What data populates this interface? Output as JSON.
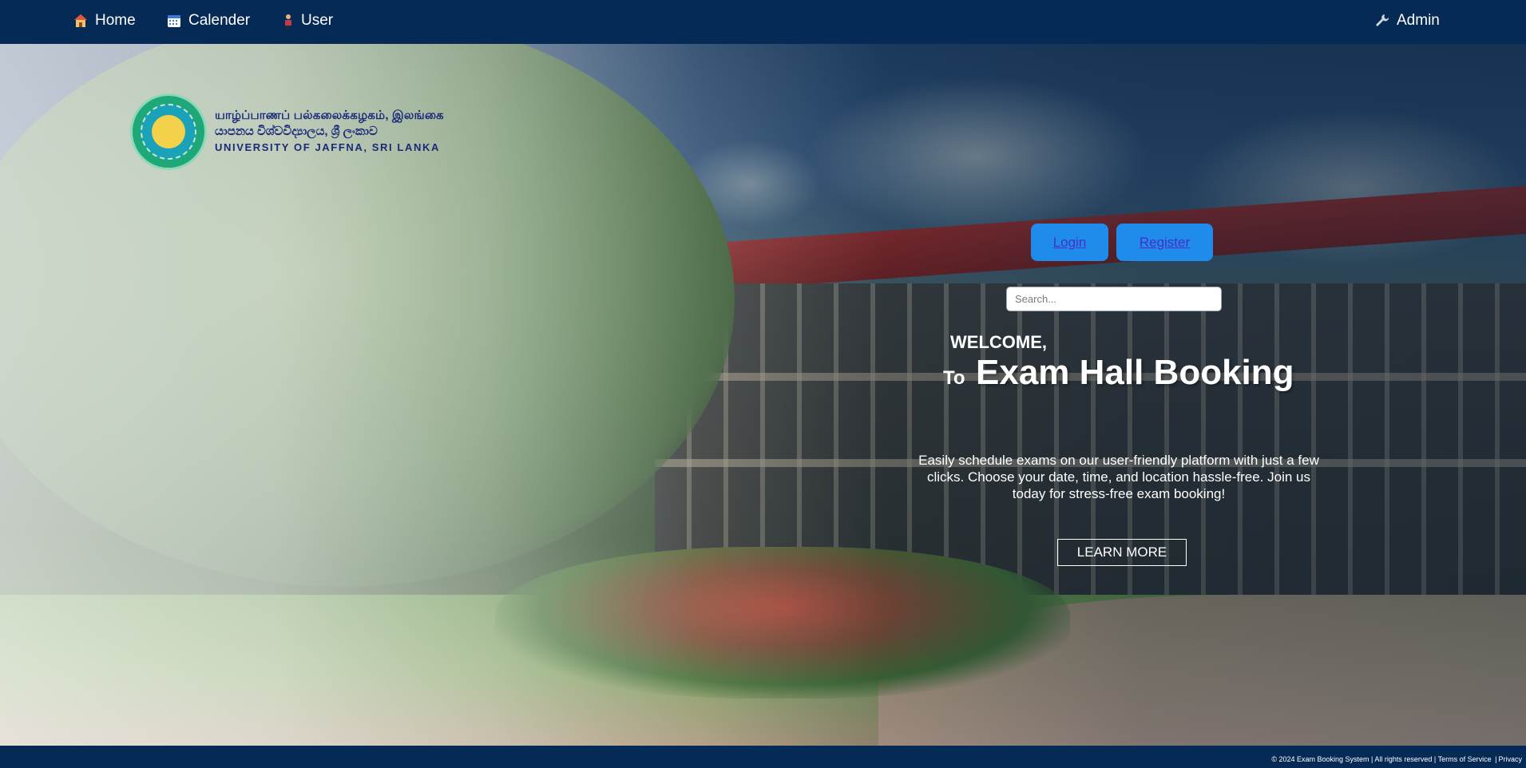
{
  "nav": {
    "home_label": "Home",
    "calender_label": "Calender",
    "user_label": "User",
    "admin_label": "Admin"
  },
  "logo": {
    "line1": "யாழ்ப்பாணப் பல்கலைக்கழகம், இலங்கை",
    "line2": "යාපනය විශ්වවිද්‍යාලය, ශ්‍රී ලංකාව",
    "line3": "UNIVERSITY OF JAFFNA, SRI LANKA"
  },
  "actions": {
    "login_label": "Login",
    "register_label": "Register"
  },
  "search": {
    "placeholder": "Search..."
  },
  "hero": {
    "welcome": "WELCOME,",
    "to": "To",
    "title": "Exam Hall Booking",
    "description": "Easily schedule exams on our user-friendly platform with just a few clicks. Choose your date, time, and location hassle-free. Join us today for stress-free exam booking!",
    "learn_more": "LEARN MORE"
  },
  "footer": {
    "copyright": "© 2024 Exam Booking System | All rights reserved |",
    "terms": "Terms of Service",
    "divider": "|",
    "privacy": "Privacy"
  },
  "colors": {
    "nav_bg": "#042a55",
    "button_bg": "#1f8bea",
    "link_text": "#4a2ec7"
  }
}
